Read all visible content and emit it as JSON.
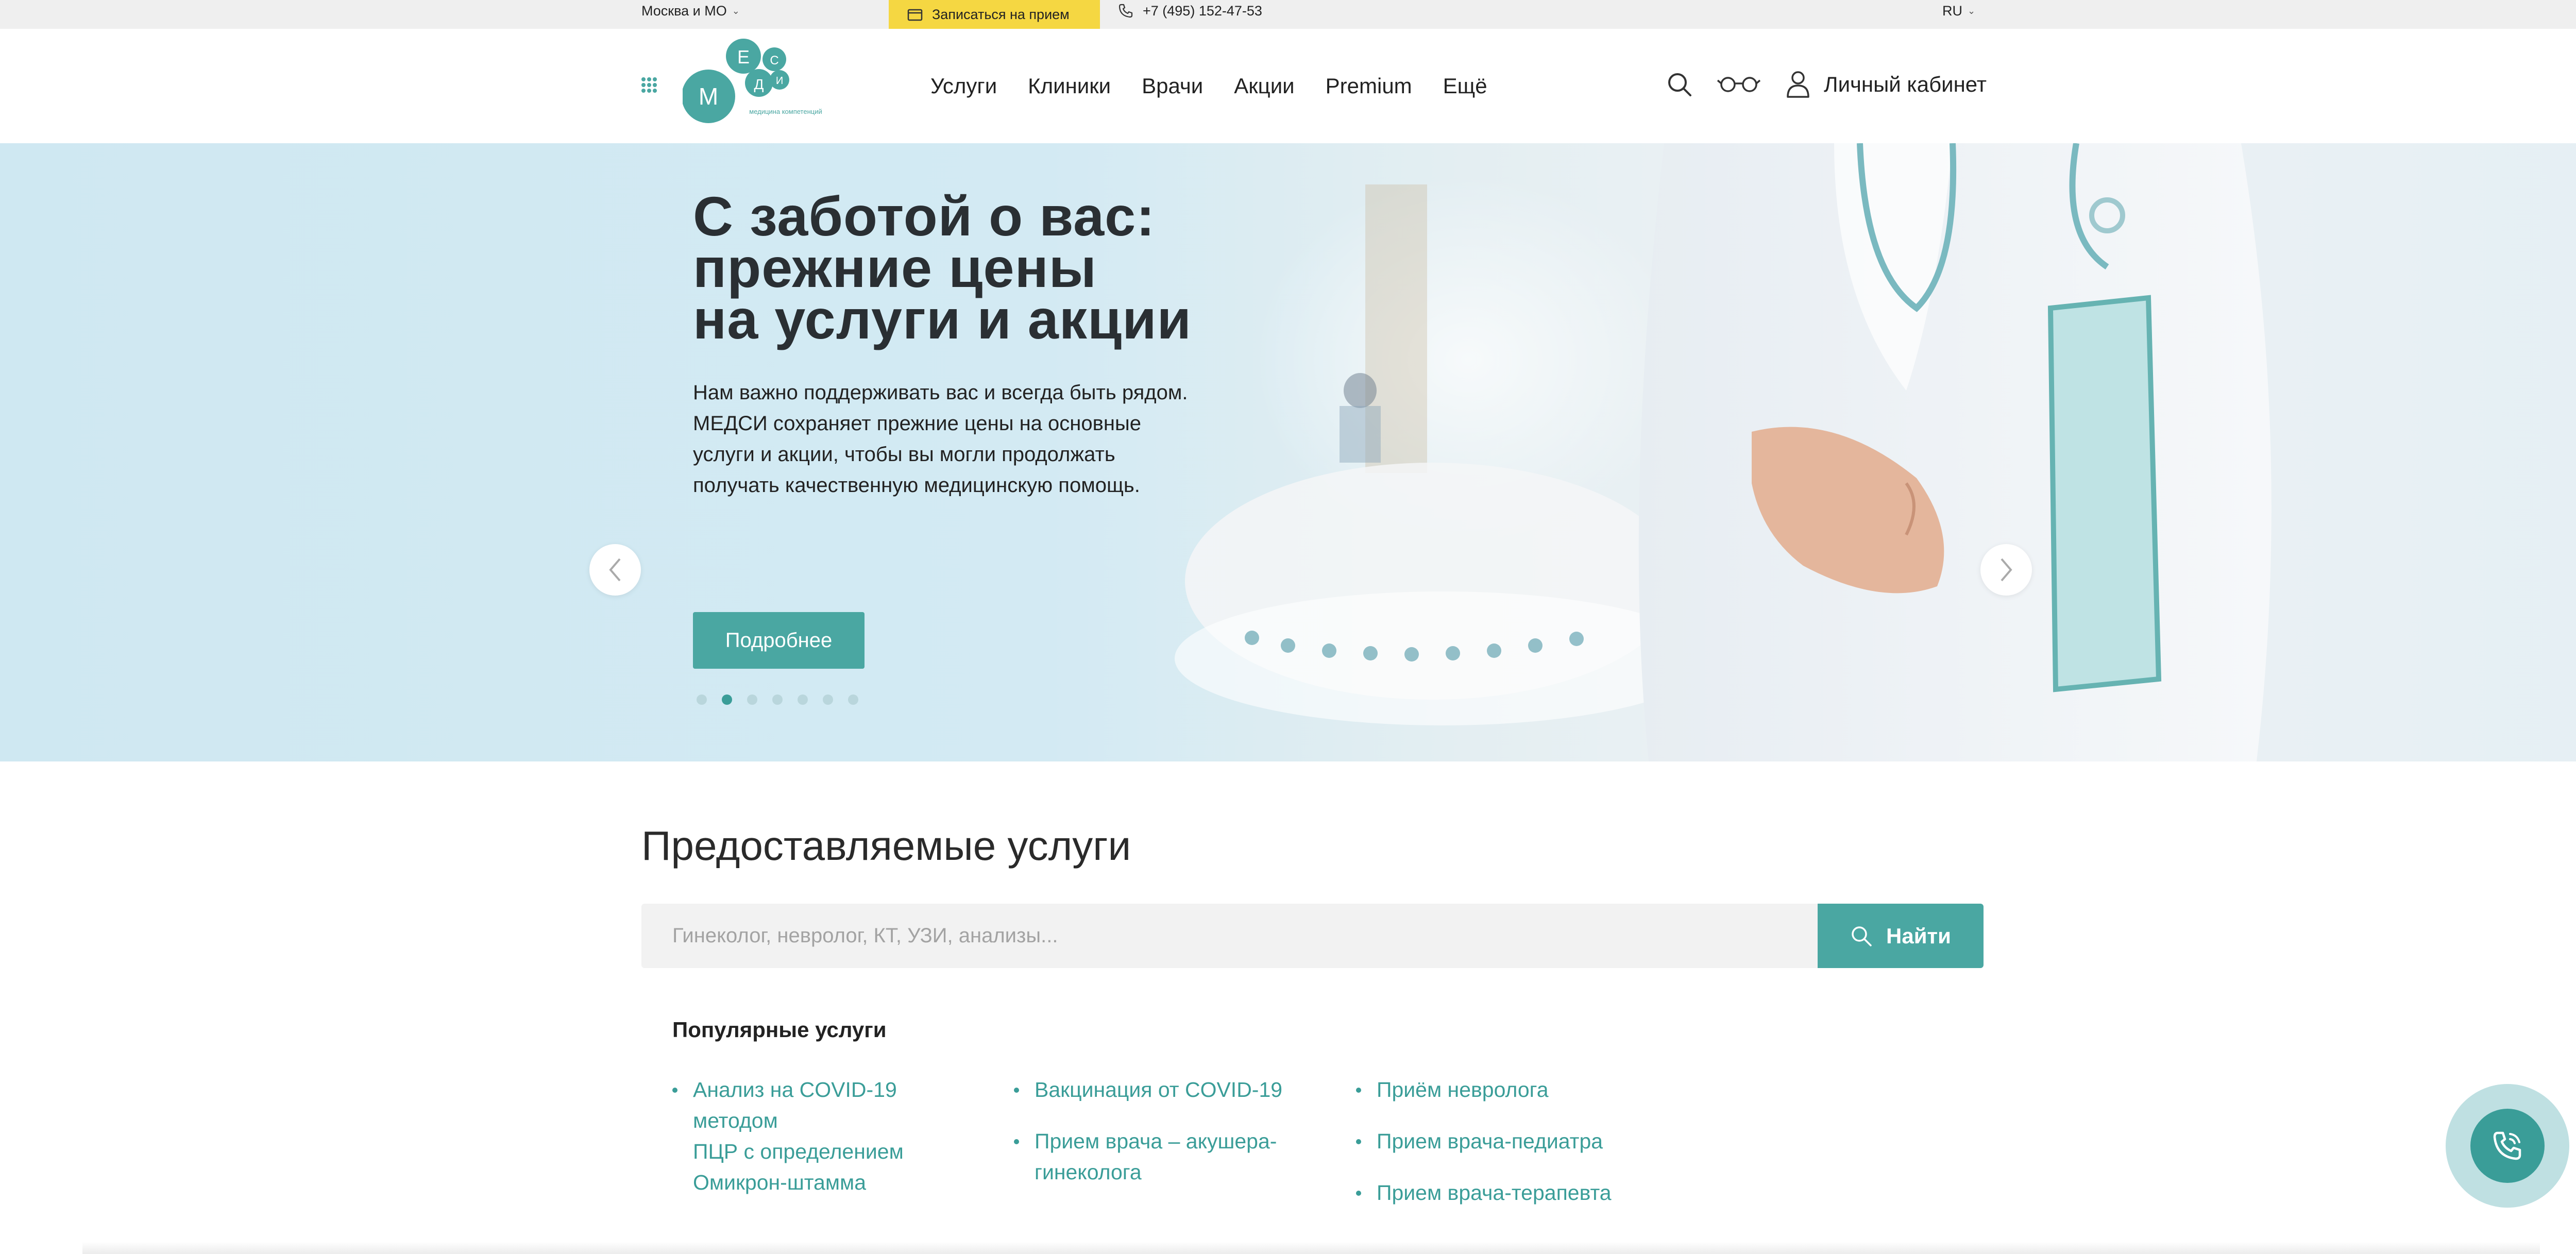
{
  "topbar": {
    "region": "Москва и МО",
    "appointment_label": "Записаться на прием",
    "phone": "+7 (495) 152-47-53",
    "language": "RU"
  },
  "header": {
    "logo_letters": [
      "М",
      "Е",
      "Д",
      "С",
      "И"
    ],
    "logo_tagline": "медицина компетенций",
    "nav": [
      "Услуги",
      "Клиники",
      "Врачи",
      "Акции",
      "Premium",
      "Ещё"
    ],
    "cabinet_label": "Личный кабинет"
  },
  "hero": {
    "title_lines": [
      "С заботой о вас:",
      "прежние цены",
      "на услуги и акции"
    ],
    "text_lines": [
      "Нам важно поддерживать вас и всегда быть рядом.",
      "МЕДСИ сохраняет прежние цены на основные",
      "услуги и акции, чтобы вы могли продолжать",
      "получать качественную медицинскую помощь."
    ],
    "button_label": "Подробнее",
    "slide_count": 7,
    "active_slide": 2
  },
  "services": {
    "title": "Предоставляемые услуги",
    "search_placeholder": "Гинеколог, невролог, КТ, УЗИ, анализы...",
    "search_button": "Найти",
    "popular_title": "Популярные услуги",
    "columns": [
      [
        {
          "lines": [
            "Анализ на COVID-19 методом",
            "ПЦР с определением",
            "Омикрон-штамма"
          ]
        }
      ],
      [
        {
          "lines": [
            "Вакцинация от COVID-19"
          ]
        },
        {
          "lines": [
            "Прием врача – акушера-",
            "гинеколога"
          ]
        }
      ],
      [
        {
          "lines": [
            "Приём невролога"
          ]
        },
        {
          "lines": [
            "Прием врача-педиатра"
          ]
        },
        {
          "lines": [
            "Прием врача-терапевта"
          ]
        }
      ]
    ]
  },
  "colors": {
    "accent": "#4aa7a2",
    "accent_dark": "#3a9d98",
    "appointment_bg": "#f5d742",
    "hero_bg": "#cfe8f2"
  },
  "icons": {
    "topbar": [
      "calendar-icon",
      "phone-icon",
      "chevron-down-icon"
    ],
    "header": [
      "menu-grid-icon",
      "search-icon",
      "glasses-icon",
      "user-icon"
    ],
    "hero": [
      "arrow-left-icon",
      "arrow-right-icon"
    ],
    "fab": "phone-call-icon"
  }
}
